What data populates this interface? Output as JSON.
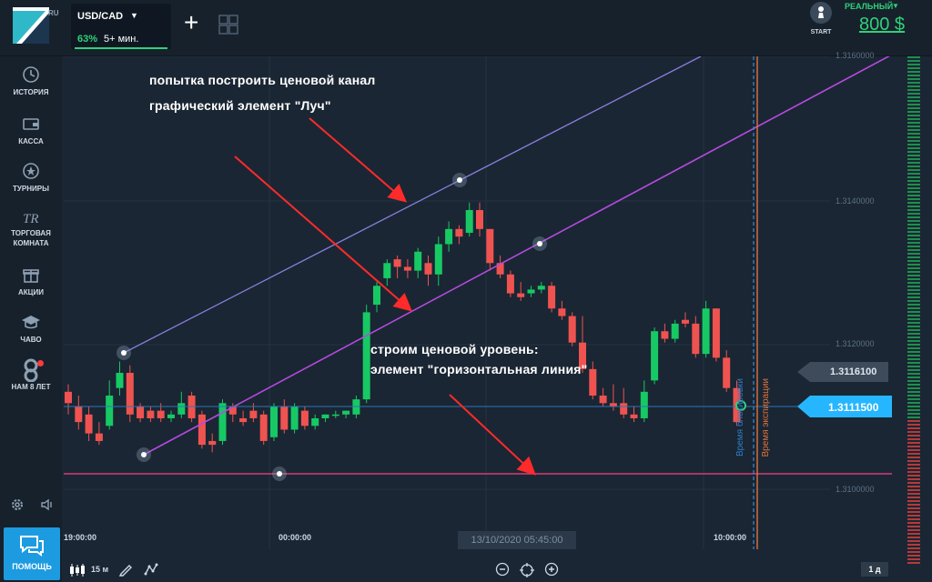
{
  "topbar": {
    "logo_badge": "RU",
    "asset": {
      "name": "USD/CAD",
      "payout": "63%",
      "expiry": "5+ мин."
    },
    "start_label": "START",
    "account_type": "РЕАЛЬНЫЙ",
    "balance": "800 $"
  },
  "sidebar": {
    "items": [
      {
        "label_lines": [
          "ИСТОРИЯ"
        ],
        "icon": "history-icon"
      },
      {
        "label_lines": [
          "КАССА"
        ],
        "icon": "wallet-icon"
      },
      {
        "label_lines": [
          "ТУРНИРЫ"
        ],
        "icon": "star-icon"
      },
      {
        "label_lines": [
          "ТОРГОВАЯ",
          "КОМНАТА"
        ],
        "icon": "tr-icon"
      },
      {
        "label_lines": [
          "АКЦИИ"
        ],
        "icon": "gift-icon"
      },
      {
        "label_lines": [
          "ЧАВО"
        ],
        "icon": "graduation-cap-icon"
      },
      {
        "label_lines": [
          "НАМ 8 ЛЕТ"
        ],
        "icon": "anniversary-8-icon"
      }
    ],
    "help_label": "ПОМОЩЬ"
  },
  "annotations": {
    "line1": "попытка построить ценовой канал",
    "line2": "графический элемент \"Луч\"",
    "line3": "строим ценовой уровень:",
    "line4": "элемент \"горизонтальная линия\""
  },
  "chart_data": {
    "type": "candlestick",
    "symbol": "USD/CAD",
    "y_ticks": [
      "1.3160000",
      "1.3140000",
      "1.3120000",
      "1.3100000"
    ],
    "ylim": [
      1.30952,
      1.31603
    ],
    "x_ticks": [
      "19:00:00",
      "00:00:00",
      "10:00:00"
    ],
    "crosshair_date": "13/10/2020 05:45:00",
    "grey_price_label": "1.3116100",
    "current_price_label": "1.3111500",
    "close_time_label": "Время блокировки",
    "expiry_time_label": "Время экспирации",
    "candles": [
      {
        "o": 1.3116,
        "h": 1.3117,
        "c": 1.31145,
        "l": 1.3113
      },
      {
        "o": 1.3114,
        "h": 1.31155,
        "c": 1.3112,
        "l": 1.3111
      },
      {
        "o": 1.3113,
        "h": 1.3114,
        "c": 1.31105,
        "l": 1.31095
      },
      {
        "o": 1.31105,
        "h": 1.3112,
        "c": 1.31095,
        "l": 1.3109
      },
      {
        "o": 1.31115,
        "h": 1.31175,
        "c": 1.31155,
        "l": 1.3111
      },
      {
        "o": 1.31165,
        "h": 1.312,
        "c": 1.31185,
        "l": 1.31155
      },
      {
        "o": 1.31185,
        "h": 1.31195,
        "c": 1.3113,
        "l": 1.3112
      },
      {
        "o": 1.3114,
        "h": 1.31145,
        "c": 1.31125,
        "l": 1.3112
      },
      {
        "o": 1.31135,
        "h": 1.3114,
        "c": 1.31125,
        "l": 1.3112
      },
      {
        "o": 1.31135,
        "h": 1.31145,
        "c": 1.31125,
        "l": 1.3112
      },
      {
        "o": 1.31125,
        "h": 1.31135,
        "c": 1.3113,
        "l": 1.3112
      },
      {
        "o": 1.3113,
        "h": 1.3116,
        "c": 1.31145,
        "l": 1.31125
      },
      {
        "o": 1.31155,
        "h": 1.3116,
        "c": 1.31125,
        "l": 1.3112
      },
      {
        "o": 1.3113,
        "h": 1.31135,
        "c": 1.3109,
        "l": 1.31085
      },
      {
        "o": 1.31095,
        "h": 1.31105,
        "c": 1.3109,
        "l": 1.3108
      },
      {
        "o": 1.31095,
        "h": 1.3115,
        "c": 1.31145,
        "l": 1.3109
      },
      {
        "o": 1.3114,
        "h": 1.31145,
        "c": 1.3113,
        "l": 1.3112
      },
      {
        "o": 1.31125,
        "h": 1.31135,
        "c": 1.3112,
        "l": 1.31115
      },
      {
        "o": 1.31135,
        "h": 1.31145,
        "c": 1.31125,
        "l": 1.3112
      },
      {
        "o": 1.3113,
        "h": 1.31135,
        "c": 1.31095,
        "l": 1.3109
      },
      {
        "o": 1.311,
        "h": 1.31145,
        "c": 1.3114,
        "l": 1.31095
      },
      {
        "o": 1.3114,
        "h": 1.3115,
        "c": 1.3111,
        "l": 1.31105
      },
      {
        "o": 1.3111,
        "h": 1.31145,
        "c": 1.3114,
        "l": 1.31105
      },
      {
        "o": 1.31135,
        "h": 1.3114,
        "c": 1.31115,
        "l": 1.3111
      },
      {
        "o": 1.31115,
        "h": 1.3113,
        "c": 1.31125,
        "l": 1.3111
      },
      {
        "o": 1.31125,
        "h": 1.3113,
        "c": 1.3113,
        "l": 1.3112
      },
      {
        "o": 1.3113,
        "h": 1.31135,
        "c": 1.3113,
        "l": 1.31125
      },
      {
        "o": 1.3113,
        "h": 1.31135,
        "c": 1.31135,
        "l": 1.31125
      },
      {
        "o": 1.3113,
        "h": 1.31155,
        "c": 1.3115,
        "l": 1.31125
      },
      {
        "o": 1.3115,
        "h": 1.31275,
        "c": 1.31265,
        "l": 1.31145
      },
      {
        "o": 1.31275,
        "h": 1.31305,
        "c": 1.313,
        "l": 1.31265
      },
      {
        "o": 1.3131,
        "h": 1.31335,
        "c": 1.3133,
        "l": 1.313
      },
      {
        "o": 1.31335,
        "h": 1.3134,
        "c": 1.31325,
        "l": 1.3131
      },
      {
        "o": 1.31325,
        "h": 1.31335,
        "c": 1.3132,
        "l": 1.3131
      },
      {
        "o": 1.3132,
        "h": 1.3135,
        "c": 1.31345,
        "l": 1.3131
      },
      {
        "o": 1.3133,
        "h": 1.3134,
        "c": 1.31315,
        "l": 1.313
      },
      {
        "o": 1.31315,
        "h": 1.31365,
        "c": 1.31355,
        "l": 1.313
      },
      {
        "o": 1.31355,
        "h": 1.31385,
        "c": 1.31375,
        "l": 1.31345
      },
      {
        "o": 1.31375,
        "h": 1.3138,
        "c": 1.31365,
        "l": 1.31355
      },
      {
        "o": 1.3137,
        "h": 1.3141,
        "c": 1.314,
        "l": 1.31365
      },
      {
        "o": 1.314,
        "h": 1.3141,
        "c": 1.31375,
        "l": 1.31365
      },
      {
        "o": 1.31375,
        "h": 1.31375,
        "c": 1.3133,
        "l": 1.3132
      },
      {
        "o": 1.3133,
        "h": 1.3134,
        "c": 1.31315,
        "l": 1.3131
      },
      {
        "o": 1.31315,
        "h": 1.3132,
        "c": 1.3129,
        "l": 1.31285
      },
      {
        "o": 1.3129,
        "h": 1.31305,
        "c": 1.31285,
        "l": 1.3128
      },
      {
        "o": 1.3129,
        "h": 1.313,
        "c": 1.31295,
        "l": 1.31285
      },
      {
        "o": 1.31295,
        "h": 1.31305,
        "c": 1.313,
        "l": 1.3129
      },
      {
        "o": 1.313,
        "h": 1.31305,
        "c": 1.3127,
        "l": 1.31265
      },
      {
        "o": 1.3127,
        "h": 1.3128,
        "c": 1.3126,
        "l": 1.31255
      },
      {
        "o": 1.3126,
        "h": 1.31265,
        "c": 1.31225,
        "l": 1.3122
      },
      {
        "o": 1.31225,
        "h": 1.3126,
        "c": 1.3119,
        "l": 1.31185
      },
      {
        "o": 1.3119,
        "h": 1.312,
        "c": 1.31155,
        "l": 1.3115
      },
      {
        "o": 1.31155,
        "h": 1.31165,
        "c": 1.31145,
        "l": 1.3114
      },
      {
        "o": 1.31145,
        "h": 1.3117,
        "c": 1.3114,
        "l": 1.31135
      },
      {
        "o": 1.31145,
        "h": 1.31165,
        "c": 1.3113,
        "l": 1.31125
      },
      {
        "o": 1.3113,
        "h": 1.3114,
        "c": 1.31125,
        "l": 1.3112
      },
      {
        "o": 1.31125,
        "h": 1.31175,
        "c": 1.3116,
        "l": 1.3112
      },
      {
        "o": 1.31175,
        "h": 1.31245,
        "c": 1.3124,
        "l": 1.3117
      },
      {
        "o": 1.3124,
        "h": 1.3125,
        "c": 1.3123,
        "l": 1.31225
      },
      {
        "o": 1.3123,
        "h": 1.31255,
        "c": 1.3125,
        "l": 1.31225
      },
      {
        "o": 1.31255,
        "h": 1.31265,
        "c": 1.3125,
        "l": 1.31245
      },
      {
        "o": 1.3125,
        "h": 1.3126,
        "c": 1.3121,
        "l": 1.31205
      },
      {
        "o": 1.3121,
        "h": 1.3128,
        "c": 1.3127,
        "l": 1.31205
      },
      {
        "o": 1.3127,
        "h": 1.31265,
        "c": 1.31205,
        "l": 1.312
      },
      {
        "o": 1.31205,
        "h": 1.31215,
        "c": 1.31165,
        "l": 1.3116
      },
      {
        "o": 1.31165,
        "h": 1.31175,
        "c": 1.3112,
        "l": 1.31115
      }
    ]
  },
  "bottombar": {
    "timeframe": "15 м",
    "period": "1 д"
  }
}
